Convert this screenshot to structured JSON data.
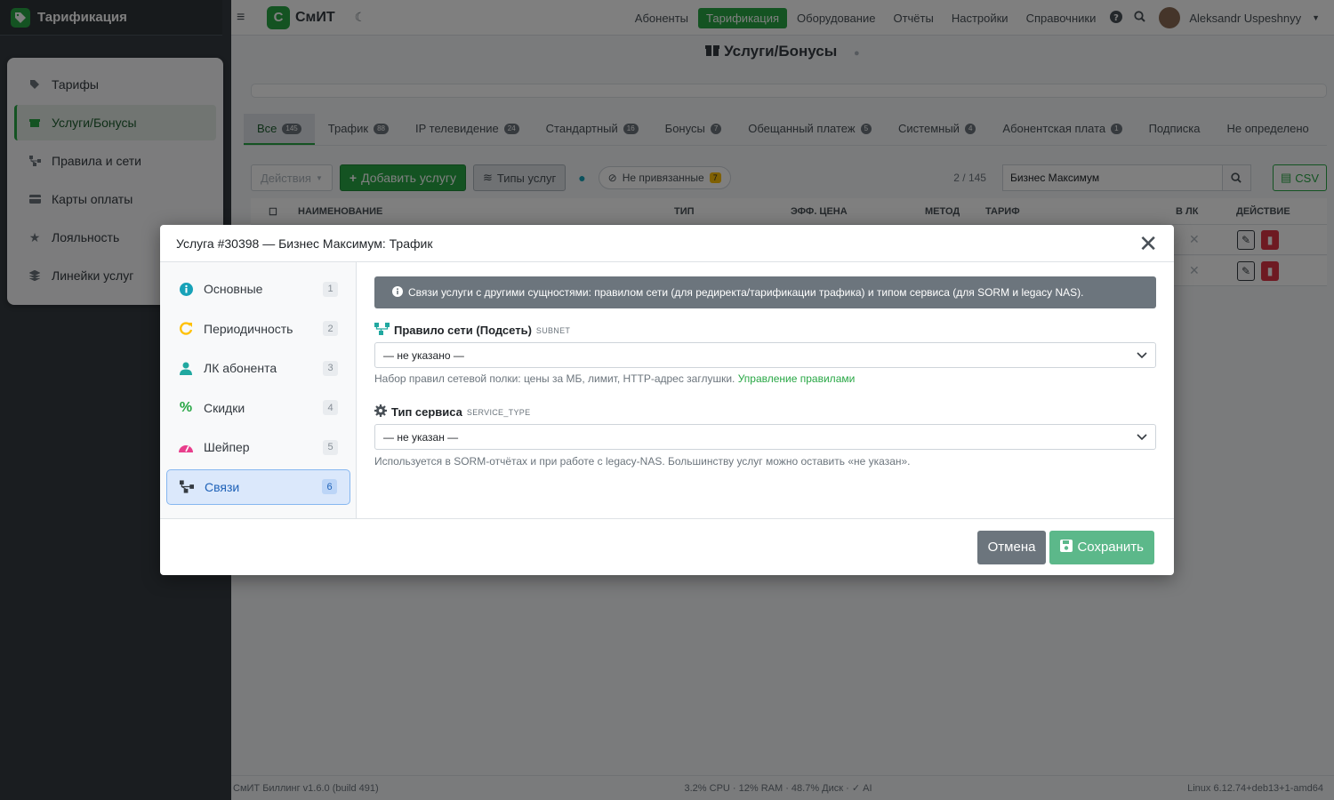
{
  "sidebar": {
    "brand": "Тарификация",
    "items": [
      {
        "label": "Тарифы",
        "icon": "tag-icon",
        "active": false
      },
      {
        "label": "Услуги/Бонусы",
        "icon": "gift-icon",
        "active": true
      },
      {
        "label": "Правила и сети",
        "icon": "network-icon",
        "active": false
      },
      {
        "label": "Карты оплаты",
        "icon": "card-icon",
        "active": false
      },
      {
        "label": "Лояльность",
        "icon": "star-icon",
        "active": false
      },
      {
        "label": "Линейки услуг",
        "icon": "layers-icon",
        "active": false
      }
    ]
  },
  "navbar": {
    "logo_letter": "С",
    "logo_text": "СмИТ",
    "links": [
      "Абоненты",
      "Тарификация",
      "Оборудование",
      "Отчёты",
      "Настройки",
      "Справочники"
    ],
    "active_link": "Тарификация",
    "user": "Aleksandr Uspeshnyy"
  },
  "page": {
    "title": "Услуги/Бонусы",
    "tabs": [
      {
        "label": "Все",
        "count": "145",
        "active": true
      },
      {
        "label": "Трафик",
        "count": "88"
      },
      {
        "label": "IP телевидение",
        "count": "24"
      },
      {
        "label": "Стандартный",
        "count": "16"
      },
      {
        "label": "Бонусы",
        "count": "7"
      },
      {
        "label": "Обещанный платеж",
        "count": "5"
      },
      {
        "label": "Системный",
        "count": "4"
      },
      {
        "label": "Абонентская плата",
        "count": "1"
      },
      {
        "label": "Подписка",
        "count": ""
      },
      {
        "label": "Не определено",
        "count": ""
      }
    ],
    "toolbar": {
      "actions": "Действия",
      "add": "Добавить услугу",
      "types": "Типы услуг",
      "unlinked": "Не привязанные",
      "unlinked_count": "7",
      "count": "2 / 145",
      "search_value": "Бизнес Максимум",
      "csv": "CSV"
    },
    "columns": [
      "НАИМЕНОВАНИЕ",
      "ТИП",
      "ЭФФ. ЦЕНА",
      "МЕТОД",
      "ТАРИФ",
      "В ЛК",
      "ДЕЙСТВИЕ"
    ]
  },
  "modal": {
    "title": "Услуга #30398 — Бизнес Максимум: Трафик",
    "nav": [
      {
        "label": "Основные",
        "num": "1",
        "icon": "info-icon",
        "color": "#17a2b8"
      },
      {
        "label": "Периодичность",
        "num": "2",
        "icon": "refresh-icon",
        "color": "#ffc107"
      },
      {
        "label": "ЛК абонента",
        "num": "3",
        "icon": "user-icon",
        "color": "#20a8a0"
      },
      {
        "label": "Скидки",
        "num": "4",
        "icon": "percent-icon",
        "color": "#28a745"
      },
      {
        "label": "Шейпер",
        "num": "5",
        "icon": "gauge-icon",
        "color": "#e83e8c"
      },
      {
        "label": "Связи",
        "num": "6",
        "icon": "network-icon",
        "color": "#343a40",
        "active": true
      }
    ],
    "alert": "Связи услуги с другими сущностями: правилом сети (для редиректа/тарификации трафика) и типом сервиса (для SORM и legacy NAS).",
    "field1": {
      "label": "Правило сети (Подсеть)",
      "code": "subnet",
      "value": "— не указано —",
      "help": "Набор правил сетевой полки: цены за МБ, лимит, HTTP-адрес заглушки.",
      "link": "Управление правилами"
    },
    "field2": {
      "label": "Тип сервиса",
      "code": "service_type",
      "value": "— не указан —",
      "help": "Используется в SORM-отчётах и при работе с legacy-NAS. Большинству услуг можно оставить «не указан»."
    },
    "cancel": "Отмена",
    "save": "Сохранить"
  },
  "statusbar": {
    "left": "СмИТ Биллинг v1.6.0 (build 491)",
    "mid": "3.2% CPU · 12% RAM · 48.7% Диск · ✓ AI",
    "right": "Linux 6.12.74+deb13+1-amd64"
  }
}
